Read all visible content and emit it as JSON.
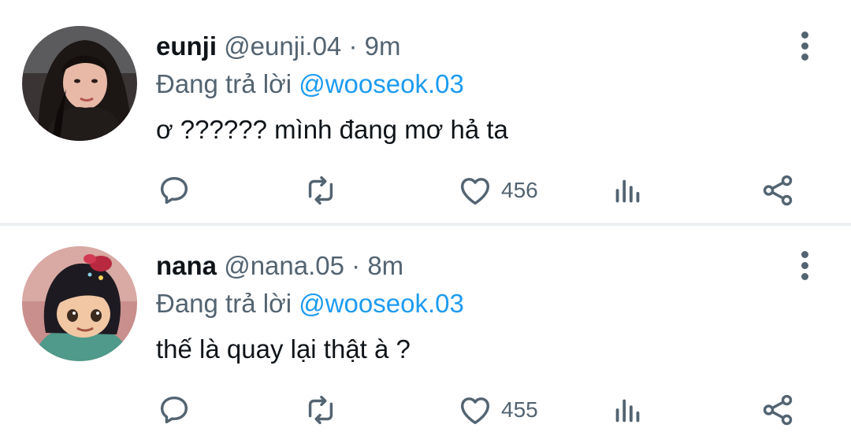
{
  "tweets": [
    {
      "name": "eunji",
      "handle": "@eunji.04",
      "separator": " · ",
      "time": "9m",
      "reply_prefix": "Đang trả lời ",
      "reply_to": "@wooseok.03",
      "text": "ơ ?????? mình đang mơ hả ta",
      "likes": "456",
      "avatar_icon": "profile-photo"
    },
    {
      "name": "nana",
      "handle": "@nana.05",
      "separator": " · ",
      "time": "8m",
      "reply_prefix": "Đang trả lời ",
      "reply_to": "@wooseok.03",
      "text": "thế là quay lại thật à ?",
      "likes": "455",
      "avatar_icon": "cartoon-avatar"
    }
  ],
  "colors": {
    "text": "#0f1419",
    "secondary": "#536471",
    "mention": "#1d9bf0",
    "divider": "#eceff1"
  }
}
